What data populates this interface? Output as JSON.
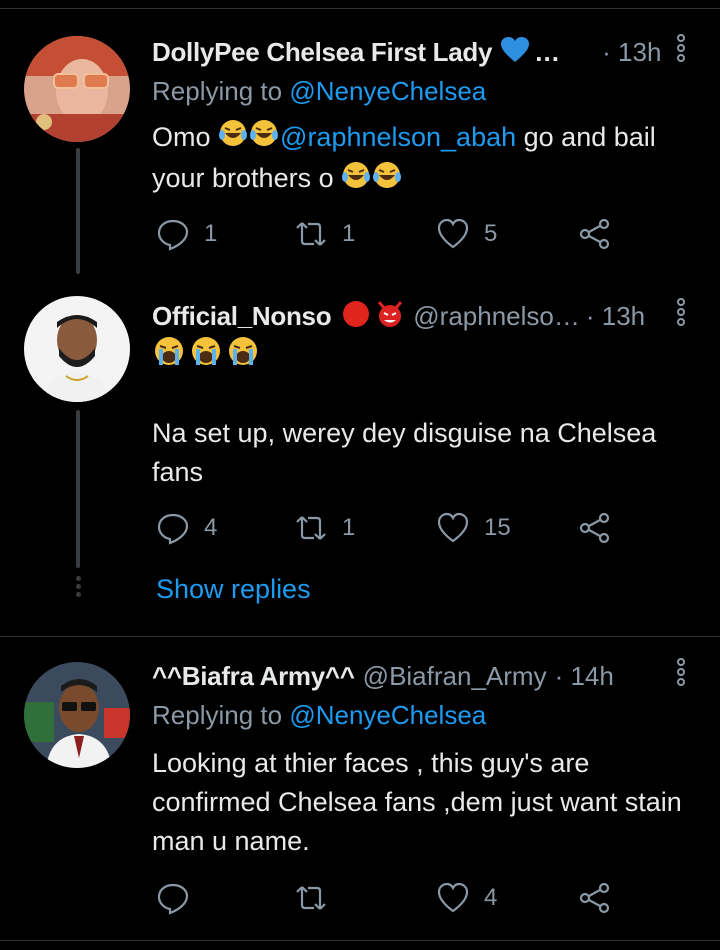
{
  "tweets": [
    {
      "name": "DollyPee Chelsea First Lady",
      "name_suffix": "…",
      "handle": "",
      "time": "· 13h",
      "replying_label": "Replying to",
      "replying_handle": "@NenyeChelsea",
      "body_text_1": "Omo",
      "mention": "@raphnelson_abah",
      "body_text_2": "go and bail",
      "body_text_3": "your brothers o",
      "replies": "1",
      "retweets": "1",
      "likes": "5",
      "icons": [
        "heart-blue-emoji",
        "laughing-emoji"
      ]
    },
    {
      "name": "Official_Nonso",
      "handle": "@raphnelso…",
      "time": "· 13h",
      "body_text": "Na set up, werey dey disguise na Chelsea fans",
      "replies": "4",
      "retweets": "1",
      "likes": "15",
      "icons": [
        "red-circle-emoji",
        "devil-emoji",
        "crying-emoji"
      ]
    },
    {
      "name": "^^Biafra Army^^",
      "handle": "@Biafran_Army",
      "time": "· 14h",
      "replying_label": "Replying to",
      "replying_handle": "@NenyeChelsea",
      "body_text": "Looking at thier faces , this guy's are confirmed Chelsea fans ,dem just want stain man u name.",
      "replies": "",
      "retweets": "",
      "likes": "4"
    }
  ],
  "show_replies": "Show replies",
  "colors": {
    "accent": "#1d9bf0",
    "muted": "#8b98a5",
    "bg": "#000000"
  }
}
